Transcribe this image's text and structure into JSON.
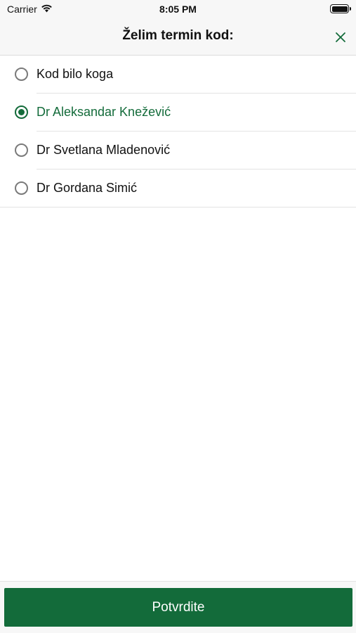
{
  "status_bar": {
    "carrier": "Carrier",
    "time": "8:05 PM"
  },
  "header": {
    "title": "Želim termin kod:",
    "close_icon": "close-icon"
  },
  "options": [
    {
      "label": "Kod bilo koga",
      "selected": false
    },
    {
      "label": "Dr Aleksandar Knežević",
      "selected": true
    },
    {
      "label": "Dr Svetlana Mladenović",
      "selected": false
    },
    {
      "label": "Dr Gordana Simić",
      "selected": false
    }
  ],
  "confirm_button": {
    "label": "Potvrdite"
  },
  "colors": {
    "accent": "#136b3a",
    "header_bg": "#f7f7f7"
  }
}
